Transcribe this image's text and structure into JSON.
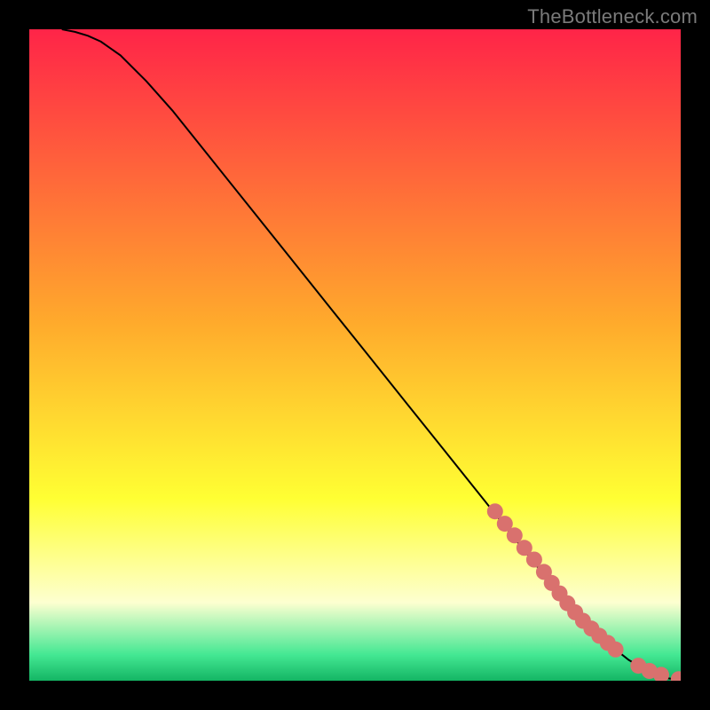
{
  "attribution": "TheBottleneck.com",
  "colors": {
    "marker": "#d9716e",
    "curve": "#000000",
    "grad_top": "#ff2448",
    "grad_orange": "#ffaa2c",
    "grad_yellow": "#ffff33",
    "grad_pale": "#fdffd0",
    "grad_green": "#44e893",
    "black": "#000000"
  },
  "chart_data": {
    "type": "line",
    "title": "",
    "xlabel": "",
    "ylabel": "",
    "xlim": [
      0,
      100
    ],
    "ylim": [
      0,
      100
    ],
    "curve": {
      "x": [
        5,
        7,
        9,
        11,
        14,
        18,
        22,
        28,
        34,
        40,
        46,
        52,
        58,
        64,
        70,
        75,
        80,
        84,
        87,
        90,
        92,
        94,
        96,
        97,
        98,
        99,
        100
      ],
      "y": [
        100,
        99.6,
        99.0,
        98.1,
        96.0,
        92.0,
        87.5,
        80.0,
        72.5,
        65.0,
        57.5,
        50.0,
        42.5,
        35.0,
        27.5,
        21.2,
        15.0,
        10.5,
        7.4,
        4.8,
        3.2,
        2.0,
        1.1,
        0.7,
        0.4,
        0.2,
        0.0
      ]
    },
    "markers": {
      "x": [
        71.5,
        73.0,
        74.5,
        76.0,
        77.5,
        79.0,
        80.2,
        81.4,
        82.6,
        83.8,
        85.0,
        86.3,
        87.5,
        88.8,
        90.0,
        93.5,
        95.2,
        97.0,
        99.7,
        101.0
      ],
      "y": [
        26.0,
        24.1,
        22.3,
        20.4,
        18.6,
        16.7,
        15.0,
        13.4,
        11.9,
        10.5,
        9.2,
        8.0,
        6.9,
        5.8,
        4.8,
        2.3,
        1.5,
        0.9,
        0.25,
        0.2
      ]
    }
  }
}
